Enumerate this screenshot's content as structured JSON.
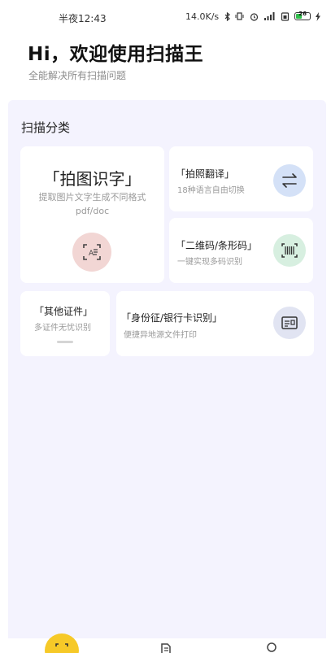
{
  "status_bar": {
    "time": "半夜12:43",
    "network_speed": "14.0K/s",
    "battery_level": "26"
  },
  "header": {
    "greeting": "Hi，欢迎使用扫描王",
    "subtitle": "全能解决所有扫描问题"
  },
  "section": {
    "title": "扫描分类"
  },
  "cards": {
    "text_recognition": {
      "title": "「拍图识字」",
      "desc_line1": "提取图片文字生成不同格式",
      "desc_line2": "pdf/doc",
      "icon": "text-scan-icon"
    },
    "translate": {
      "title": "「拍照翻译」",
      "desc": "18种语言自由切换",
      "icon": "swap-arrows-icon"
    },
    "qr_code": {
      "title": "「二维码/条形码」",
      "desc": "一键实现多码识别",
      "icon": "barcode-scan-icon"
    },
    "other_docs": {
      "title": "「其他证件」",
      "desc": "多证件无忧识别"
    },
    "id_card": {
      "title": "「身份征/银行卡识别」",
      "desc": "便捷异地源文件打印",
      "icon": "id-card-icon"
    }
  },
  "colors": {
    "background": "#f4f3fe",
    "accent_yellow": "#f6c928",
    "text_card_icon_bg": "#f2d6d4",
    "translate_icon_bg": "#d4e1f7",
    "qr_icon_bg": "#d7efe0",
    "id_icon_bg": "#e1e4f2"
  }
}
